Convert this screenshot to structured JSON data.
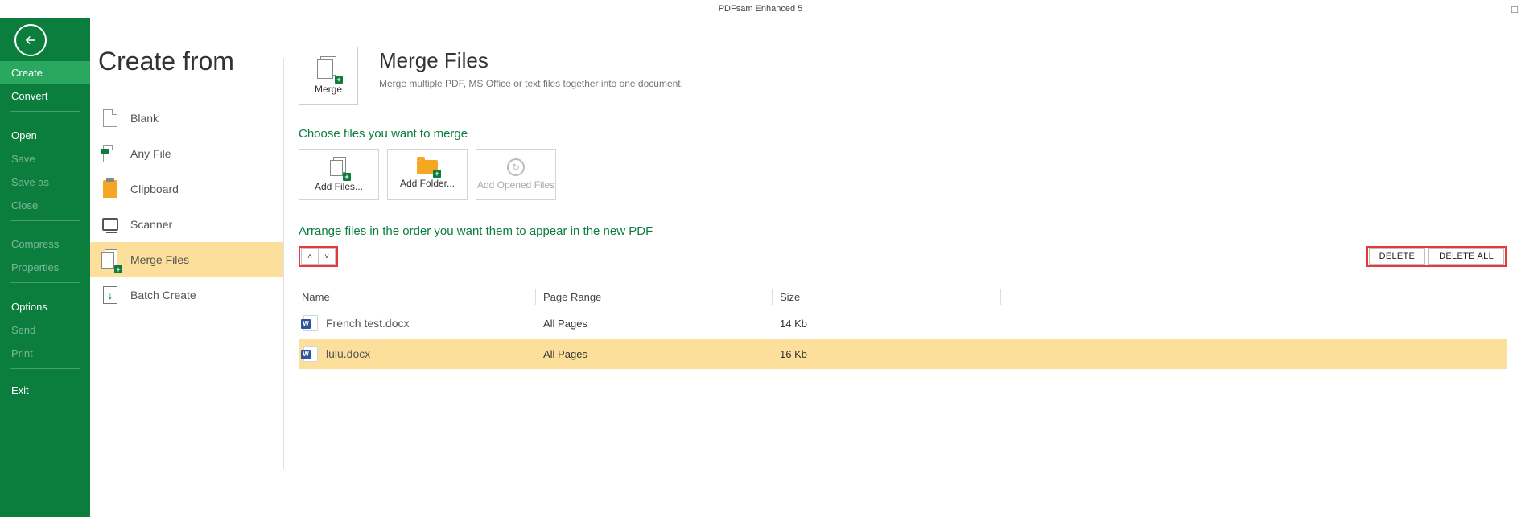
{
  "window": {
    "title": "PDFsam Enhanced 5"
  },
  "sidebar": {
    "items": [
      {
        "label": "Create",
        "selected": true,
        "dim": false
      },
      {
        "label": "Convert",
        "selected": false,
        "dim": false
      }
    ],
    "open_group": {
      "heading": "Open",
      "items": [
        {
          "label": "Save",
          "dim": true
        },
        {
          "label": "Save as",
          "dim": true
        },
        {
          "label": "Close",
          "dim": true
        }
      ]
    },
    "tools_group": {
      "items": [
        {
          "label": "Compress",
          "dim": true
        },
        {
          "label": "Properties",
          "dim": true
        }
      ]
    },
    "options_group": {
      "heading": "Options",
      "items": [
        {
          "label": "Send",
          "dim": true
        },
        {
          "label": "Print",
          "dim": true
        }
      ]
    },
    "exit": "Exit"
  },
  "create_from": {
    "title": "Create from",
    "items": [
      {
        "key": "blank",
        "label": "Blank"
      },
      {
        "key": "anyfile",
        "label": "Any File"
      },
      {
        "key": "clipboard",
        "label": "Clipboard"
      },
      {
        "key": "scanner",
        "label": "Scanner"
      },
      {
        "key": "merge",
        "label": "Merge Files",
        "selected": true
      },
      {
        "key": "batch",
        "label": "Batch Create"
      }
    ]
  },
  "merge": {
    "button_label": "Merge",
    "title": "Merge Files",
    "description": "Merge multiple PDF, MS Office or text files together into one document.",
    "choose_heading": "Choose files you want to merge",
    "actions": {
      "add_files": "Add Files...",
      "add_folder": "Add Folder...",
      "add_opened": "Add Opened Files"
    },
    "arrange_heading": "Arrange files in the order you want them to appear in the new PDF",
    "delete_btn": "DELETE",
    "delete_all_btn": "DELETE ALL",
    "columns": {
      "name": "Name",
      "range": "Page Range",
      "size": "Size"
    },
    "files": [
      {
        "name": "French test.docx",
        "range": "All Pages",
        "size": "14 Kb",
        "selected": false
      },
      {
        "name": "lulu.docx",
        "range": "All Pages",
        "size": "16 Kb",
        "selected": true
      }
    ]
  }
}
